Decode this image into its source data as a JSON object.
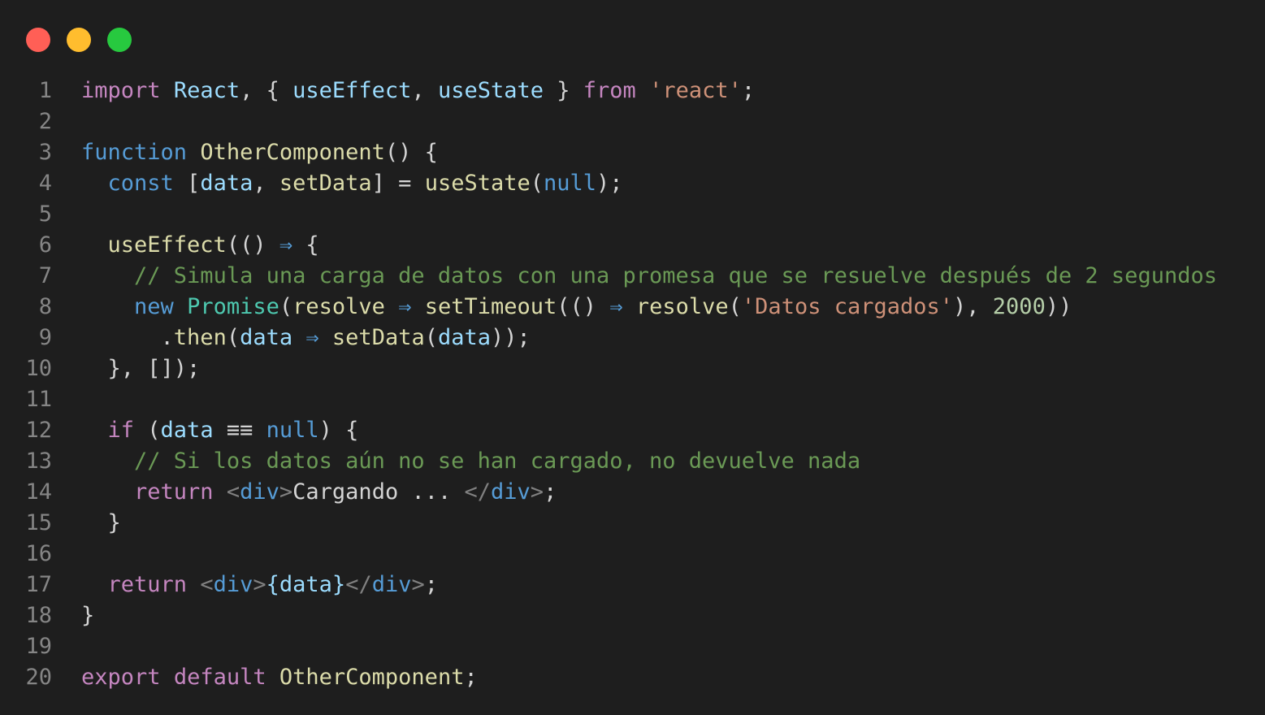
{
  "window": {
    "controls": {
      "close_color": "#ff5f56",
      "minimize_color": "#ffbd2e",
      "maximize_color": "#27c93f"
    }
  },
  "theme": {
    "background": "#1e1e1e",
    "line_number": "#858585",
    "keyword": "#c586c0",
    "storage": "#569cd6",
    "variable": "#9cdcfe",
    "function": "#dcdcaa",
    "type": "#4ec9b0",
    "string": "#ce9178",
    "number": "#b5cea8",
    "comment": "#6a9955",
    "plain": "#d4d4d4"
  },
  "code": {
    "language": "javascript-jsx",
    "lines": [
      {
        "n": "1",
        "tokens": [
          [
            "import",
            "kw"
          ],
          [
            " ",
            "txt"
          ],
          [
            "React",
            "var"
          ],
          [
            ", { ",
            "txt"
          ],
          [
            "useEffect",
            "var"
          ],
          [
            ", ",
            "txt"
          ],
          [
            "useState",
            "var"
          ],
          [
            " } ",
            "txt"
          ],
          [
            "from",
            "kw"
          ],
          [
            " ",
            "txt"
          ],
          [
            "'react'",
            "str"
          ],
          [
            ";",
            "txt"
          ]
        ]
      },
      {
        "n": "2",
        "tokens": []
      },
      {
        "n": "3",
        "tokens": [
          [
            "function",
            "st"
          ],
          [
            " ",
            "txt"
          ],
          [
            "OtherComponent",
            "fn"
          ],
          [
            "() {",
            "txt"
          ]
        ]
      },
      {
        "n": "4",
        "tokens": [
          [
            "  ",
            "txt"
          ],
          [
            "const",
            "st"
          ],
          [
            " [",
            "txt"
          ],
          [
            "data",
            "var"
          ],
          [
            ", ",
            "txt"
          ],
          [
            "setData",
            "fn"
          ],
          [
            "] = ",
            "txt"
          ],
          [
            "useState",
            "fn"
          ],
          [
            "(",
            "txt"
          ],
          [
            "null",
            "st"
          ],
          [
            ");",
            "txt"
          ]
        ]
      },
      {
        "n": "5",
        "tokens": []
      },
      {
        "n": "6",
        "tokens": [
          [
            "  ",
            "txt"
          ],
          [
            "useEffect",
            "fn"
          ],
          [
            "(() ",
            "txt"
          ],
          [
            "⇒",
            "st"
          ],
          [
            " {",
            "txt"
          ]
        ]
      },
      {
        "n": "7",
        "tokens": [
          [
            "    ",
            "txt"
          ],
          [
            "// Simula una carga de datos con una promesa que se resuelve después de 2 segundos",
            "com"
          ]
        ]
      },
      {
        "n": "8",
        "tokens": [
          [
            "    ",
            "txt"
          ],
          [
            "new",
            "st"
          ],
          [
            " ",
            "txt"
          ],
          [
            "Promise",
            "ty"
          ],
          [
            "(",
            "txt"
          ],
          [
            "resolve",
            "fn"
          ],
          [
            " ",
            "txt"
          ],
          [
            "⇒",
            "st"
          ],
          [
            " ",
            "txt"
          ],
          [
            "setTimeout",
            "fn"
          ],
          [
            "(() ",
            "txt"
          ],
          [
            "⇒",
            "st"
          ],
          [
            " ",
            "txt"
          ],
          [
            "resolve",
            "fn"
          ],
          [
            "(",
            "txt"
          ],
          [
            "'Datos cargados'",
            "str"
          ],
          [
            "), ",
            "txt"
          ],
          [
            "2000",
            "num"
          ],
          [
            "))",
            "txt"
          ]
        ]
      },
      {
        "n": "9",
        "tokens": [
          [
            "      .",
            "txt"
          ],
          [
            "then",
            "fn"
          ],
          [
            "(",
            "txt"
          ],
          [
            "data",
            "var"
          ],
          [
            " ",
            "txt"
          ],
          [
            "⇒",
            "st"
          ],
          [
            " ",
            "txt"
          ],
          [
            "setData",
            "fn"
          ],
          [
            "(",
            "txt"
          ],
          [
            "data",
            "var"
          ],
          [
            "));",
            "txt"
          ]
        ]
      },
      {
        "n": "10",
        "tokens": [
          [
            "  }, []);",
            "txt"
          ]
        ]
      },
      {
        "n": "11",
        "tokens": []
      },
      {
        "n": "12",
        "tokens": [
          [
            "  ",
            "txt"
          ],
          [
            "if",
            "kw"
          ],
          [
            " (",
            "txt"
          ],
          [
            "data",
            "var"
          ],
          [
            " ≡≡ ",
            "txt"
          ],
          [
            "null",
            "st"
          ],
          [
            ") {",
            "txt"
          ]
        ]
      },
      {
        "n": "13",
        "tokens": [
          [
            "    ",
            "txt"
          ],
          [
            "// Si los datos aún no se han cargado, no devuelve nada",
            "com"
          ]
        ]
      },
      {
        "n": "14",
        "tokens": [
          [
            "    ",
            "txt"
          ],
          [
            "return",
            "kw"
          ],
          [
            " ",
            "txt"
          ],
          [
            "<",
            "br"
          ],
          [
            "div",
            "tag"
          ],
          [
            ">",
            "br"
          ],
          [
            "Cargando ...",
            "txt"
          ],
          [
            " </",
            "br"
          ],
          [
            "div",
            "tag"
          ],
          [
            ">",
            "br"
          ],
          [
            ";",
            "txt"
          ]
        ]
      },
      {
        "n": "15",
        "tokens": [
          [
            "  }",
            "txt"
          ]
        ]
      },
      {
        "n": "16",
        "tokens": []
      },
      {
        "n": "17",
        "tokens": [
          [
            "  ",
            "txt"
          ],
          [
            "return",
            "kw"
          ],
          [
            " ",
            "txt"
          ],
          [
            "<",
            "br"
          ],
          [
            "div",
            "tag"
          ],
          [
            ">",
            "br"
          ],
          [
            "{data}",
            "var"
          ],
          [
            "</",
            "br"
          ],
          [
            "div",
            "tag"
          ],
          [
            ">",
            "br"
          ],
          [
            ";",
            "txt"
          ]
        ]
      },
      {
        "n": "18",
        "tokens": [
          [
            "}",
            "txt"
          ]
        ]
      },
      {
        "n": "19",
        "tokens": []
      },
      {
        "n": "20",
        "tokens": [
          [
            "export",
            "kw"
          ],
          [
            " ",
            "txt"
          ],
          [
            "default",
            "kw"
          ],
          [
            " ",
            "txt"
          ],
          [
            "OtherComponent",
            "fn"
          ],
          [
            ";",
            "txt"
          ]
        ]
      }
    ]
  }
}
